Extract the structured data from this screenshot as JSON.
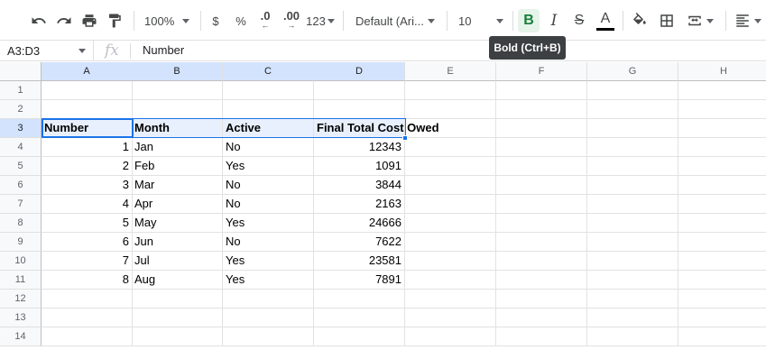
{
  "toolbar": {
    "zoom": "100%",
    "currency": "$",
    "percent": "%",
    "decrease_decimal": ".0",
    "increase_decimal": ".00",
    "more_formats": "123",
    "font": "Default (Ari...",
    "font_size": "10",
    "bold": "B",
    "italic": "I",
    "strikethrough": "S",
    "text_color": "A"
  },
  "tooltip": "Bold (Ctrl+B)",
  "formula_bar": {
    "name_box": "A3:D3",
    "fx": "fx",
    "value": "Number"
  },
  "columns": [
    "A",
    "B",
    "C",
    "D",
    "E",
    "F",
    "G",
    "H"
  ],
  "rows": [
    "1",
    "2",
    "3",
    "4",
    "5",
    "6",
    "7",
    "8",
    "9",
    "10",
    "11",
    "12",
    "13",
    "14"
  ],
  "header_row": [
    "Number",
    "Month",
    "Active",
    "Final Total Cost Owed"
  ],
  "data_rows": [
    [
      "1",
      "Jan",
      "No",
      "12343"
    ],
    [
      "2",
      "Feb",
      "Yes",
      "1091"
    ],
    [
      "3",
      "Mar",
      "No",
      "3844"
    ],
    [
      "4",
      "Apr",
      "No",
      "2163"
    ],
    [
      "5",
      "May",
      "Yes",
      "24666"
    ],
    [
      "6",
      "Jun",
      "No",
      "7622"
    ],
    [
      "7",
      "Jul",
      "Yes",
      "23581"
    ],
    [
      "8",
      "Aug",
      "Yes",
      "7891"
    ]
  ],
  "colors": {
    "selection": "#1a73e8",
    "selection_fill": "#e8f0fe",
    "bold_active": "#188038",
    "tooltip_bg": "#3c4043"
  }
}
